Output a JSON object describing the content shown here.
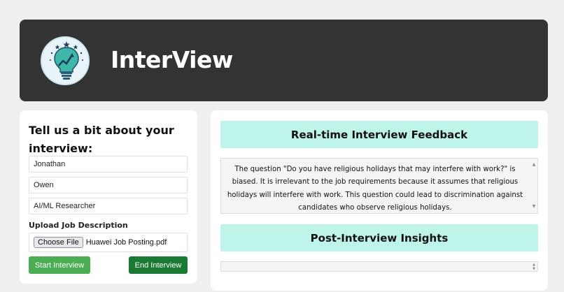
{
  "header": {
    "app_title": "InterView",
    "logo_icon": "lightbulb-growth-logo-icon"
  },
  "form": {
    "title": "Tell us a bit about your interview:",
    "first_name_value": "Jonathan",
    "last_name_value": "Owen",
    "role_value": "AI/ML Researcher",
    "upload_label": "Upload Job Description",
    "choose_file_label": "Choose File",
    "file_name": "Huawei Job Posting.pdf",
    "start_label": "Start Interview",
    "end_label": "End Interview"
  },
  "feedback": {
    "title": "Real-time Interview Feedback",
    "text": "The question \"Do you have religious holidays that may interfere with work?\" is biased. It is irrelevant to the job requirements because it assumes that religious holidays will interfere with work. This question could lead to discrimination against candidates who observe religious holidays."
  },
  "insights": {
    "title": "Post-Interview Insights",
    "text": ""
  },
  "colors": {
    "header_bg": "#333333",
    "section_head_bg": "#bff4ea",
    "start_button": "#4cae53",
    "end_button": "#1a7a33",
    "page_bg": "#efefef"
  }
}
